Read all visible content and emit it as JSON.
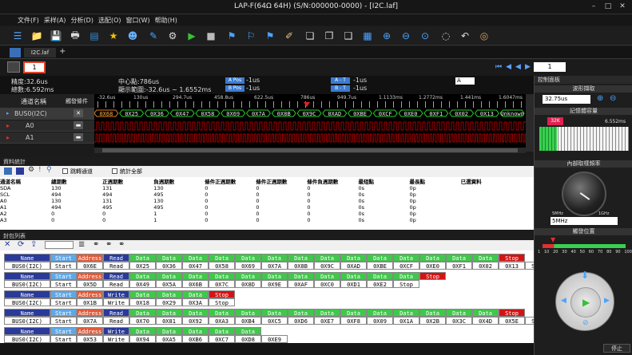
{
  "window": {
    "title": "LAP-F(64Ω 64H) (S/N:000000-0000) - [I2C.laf]"
  },
  "menu": [
    "文件(F)",
    "采样(A)",
    "分析(D)",
    "选配(O)",
    "窗口(W)",
    "帮助(H)"
  ],
  "tabs": {
    "file": "I2C.laf",
    "page_number": "1",
    "page_field": "1"
  },
  "info": {
    "accuracy": "精度:32.6us",
    "total": "總數:6.592ms",
    "center": "中心點:786us",
    "range": "顯示範圍:-32.6us ~ 1.6552ms",
    "a_pos": "A Pos",
    "a_pos_val": "-1us",
    "b_pos": "B Pos",
    "b_pos_val": "-1us",
    "a_t": "A - T",
    "a_t_val": "-1us",
    "b_t": "B - T",
    "b_t_val": "-1us",
    "cursor_select": "A"
  },
  "wave": {
    "channel_header": "通道名稱",
    "trigger_header": "觸發條件",
    "ticks": [
      "-32.6us",
      "130us",
      "294.7us",
      "458.8us",
      "622.5us",
      "786us",
      "949.7us",
      "1.1133ms",
      "1.2772ms",
      "1.441ms",
      "1.6047ms"
    ],
    "channels": [
      {
        "name": "BUS0(I2C)"
      },
      {
        "name": "A0",
        "id": "A0"
      },
      {
        "name": "A1",
        "id": "A1"
      }
    ],
    "bus_labels": [
      "0X68",
      "0X25",
      "0X36",
      "0X47",
      "0X58",
      "0X69",
      "0X7A",
      "0X8B",
      "0X9C",
      "0XAD",
      "0XBE",
      "0XCF",
      "0XE0",
      "0XF1",
      "0X02",
      "0X13",
      "Unknown"
    ]
  },
  "stats": {
    "title": "資料統計",
    "checkbox1": "跳轉通道",
    "checkbox2": "統計全部",
    "headers": [
      "通道名稱",
      "總期數",
      "正週期數",
      "負週期數",
      "條件正週期數",
      "條件正週期數",
      "條件負週期數",
      "最短點",
      "最長點",
      "已選資料"
    ],
    "rows": [
      [
        "SDA",
        "130",
        "131",
        "130",
        "0",
        "0",
        "0",
        "0s",
        "0p",
        ""
      ],
      [
        "SCL",
        "494",
        "494",
        "495",
        "0",
        "0",
        "0",
        "0s",
        "0p",
        ""
      ],
      [
        "A0",
        "130",
        "131",
        "130",
        "0",
        "0",
        "0",
        "0s",
        "0p",
        ""
      ],
      [
        "A1",
        "494",
        "495",
        "495",
        "0",
        "0",
        "0",
        "0s",
        "0p",
        ""
      ],
      [
        "A2",
        "0",
        "0",
        "1",
        "0",
        "0",
        "0",
        "0s",
        "0p",
        ""
      ],
      [
        "A3",
        "0",
        "0",
        "1",
        "0",
        "0",
        "0",
        "0s",
        "0p",
        ""
      ]
    ]
  },
  "packets": {
    "title": "封包列表",
    "rows": [
      {
        "hdr": [
          "Name",
          "Start",
          "Address",
          "Read",
          "Data",
          "Data",
          "Data",
          "Data",
          "Data",
          "Data",
          "Data",
          "Data",
          "Data",
          "Data",
          "Data",
          "Data",
          "Data",
          "Data",
          "Stop"
        ],
        "val": [
          "BUS0(I2C)",
          "Start",
          "0X6E",
          "Read",
          "0X25",
          "0X36",
          "0X47",
          "0X58",
          "0X69",
          "0X7A",
          "0X8B",
          "0X9C",
          "0XAD",
          "0XBE",
          "0XCF",
          "0XE0",
          "0XF1",
          "0X02",
          "0X13",
          "Stop"
        ]
      },
      {
        "hdr": [
          "Name",
          "Start",
          "Address",
          "Read",
          "Data",
          "Data",
          "Data",
          "Data",
          "Data",
          "Data",
          "Data",
          "Data",
          "Data",
          "Data",
          "Data",
          "Stop"
        ],
        "val": [
          "BUS0(I2C)",
          "Start",
          "0X5D",
          "Read",
          "0X49",
          "0X5A",
          "0X6B",
          "0X7C",
          "0X8D",
          "0X9E",
          "0XAF",
          "0XC0",
          "0XD1",
          "0XE2",
          "Stop"
        ]
      },
      {
        "hdr": [
          "Name",
          "Start",
          "Address",
          "Write",
          "Data",
          "Data",
          "Data",
          "Stop"
        ],
        "val": [
          "BUS0(I2C)",
          "Start",
          "0X1B",
          "Write",
          "0X18",
          "0X29",
          "0X3A",
          "Stop"
        ]
      },
      {
        "hdr": [
          "Name",
          "Start",
          "Address",
          "Read",
          "Data",
          "Data",
          "Data",
          "Data",
          "Data",
          "Data",
          "Data",
          "Data",
          "Data",
          "Data",
          "Data",
          "Data",
          "Data",
          "Data",
          "Stop"
        ],
        "val": [
          "BUS0(I2C)",
          "Start",
          "0X7A",
          "Read",
          "0X70",
          "0X81",
          "0X92",
          "0XA3",
          "0XB4",
          "0XC5",
          "0XD6",
          "0XE7",
          "0XF8",
          "0X09",
          "0X1A",
          "0X2B",
          "0X3C",
          "0X4D",
          "0X5E",
          "Stop"
        ]
      },
      {
        "hdr": [
          "Name",
          "Start",
          "Address",
          "Write",
          "Data",
          "Data",
          "Data",
          "Data",
          "Data"
        ],
        "val": [
          "BUS0(I2C)",
          "Start",
          "0X53",
          "Write",
          "0X94",
          "0XA5",
          "0XB6",
          "0XC7",
          "0XD8",
          "0XE9"
        ]
      }
    ]
  },
  "right": {
    "panel_title": "控制面板",
    "wave_title": "波形擷取",
    "wave_value": "32.75us",
    "memory_title": "記憶體容量",
    "memory_level": "32K",
    "memory_value": "6.552ms",
    "sample_title": "內部取樣頻率",
    "sample_min": "5MHz",
    "sample_max": "1GHz",
    "sample_value": "5MHz",
    "trigger_title": "觸發位置",
    "trigger_scale": [
      "1",
      "10",
      "20",
      "30",
      "40",
      "50",
      "60",
      "70",
      "80",
      "90",
      "100"
    ],
    "stop": "停止"
  },
  "colors": {
    "bus": "#007a00",
    "wave_red": "#d00000",
    "hdr_name": "#2a3a9a",
    "hdr_start": "#5fa8e8",
    "hdr_addr": "#e05a3a",
    "hdr_data": "#3fc84a",
    "hdr_stop": "#d21414"
  }
}
